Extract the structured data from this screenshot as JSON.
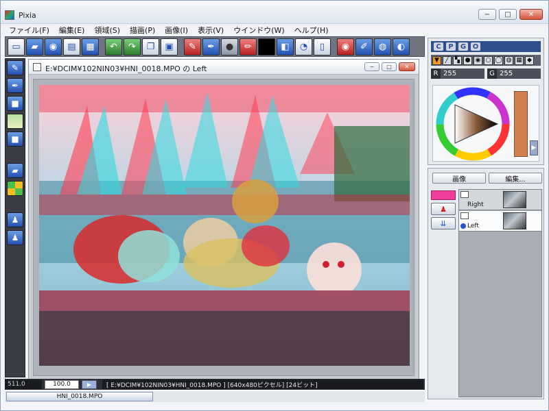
{
  "app": {
    "title": "Pixia"
  },
  "window_controls": {
    "minimize": "−",
    "maximize": "□",
    "close": "✕"
  },
  "menu": {
    "items": [
      "ファイル(F)",
      "編集(E)",
      "領域(S)",
      "描画(P)",
      "画像(I)",
      "表示(V)",
      "ウインドウ(W)",
      "ヘルプ(H)"
    ]
  },
  "toolbar": {
    "icons": [
      "new-icon",
      "open-icon",
      "camera-icon",
      "save-icon",
      "print-icon",
      "undo-icon",
      "redo-icon",
      "copy-icon",
      "paste-icon",
      "brush-icon",
      "pen-icon",
      "sphere-icon",
      "pencil-icon",
      "color-black-icon",
      "layer-icon",
      "timer-icon",
      "document-icon",
      "record-icon",
      "edit-icon",
      "globe-icon",
      "globe2-icon"
    ]
  },
  "document": {
    "title": "E:¥DCIM¥102NIN03¥HNI_0018.MPO の Left"
  },
  "color_panel": {
    "tabs": [
      "C",
      "P",
      "G",
      "O"
    ],
    "r_label": "R",
    "r_value": "255",
    "g_label": "G",
    "g_value": "255",
    "accent_color": "#d08050",
    "header_color": "#2f4f8c"
  },
  "layer_panel": {
    "image_button": "画像",
    "edit_button": "編集...",
    "layers": [
      {
        "name": "Right",
        "selected": false
      },
      {
        "name": "Left",
        "selected": true
      }
    ],
    "swatch_color": "#ef3f9a"
  },
  "status": {
    "coord": "511.0",
    "zoom": "100.0",
    "play": "▶",
    "info": "[ E:¥DCIM¥102NIN03¥HNI_0018.MPO ] [640x480ピクセル] [24ビット]"
  },
  "taskbar": {
    "tab_label": "HNI_0018.MPO"
  }
}
